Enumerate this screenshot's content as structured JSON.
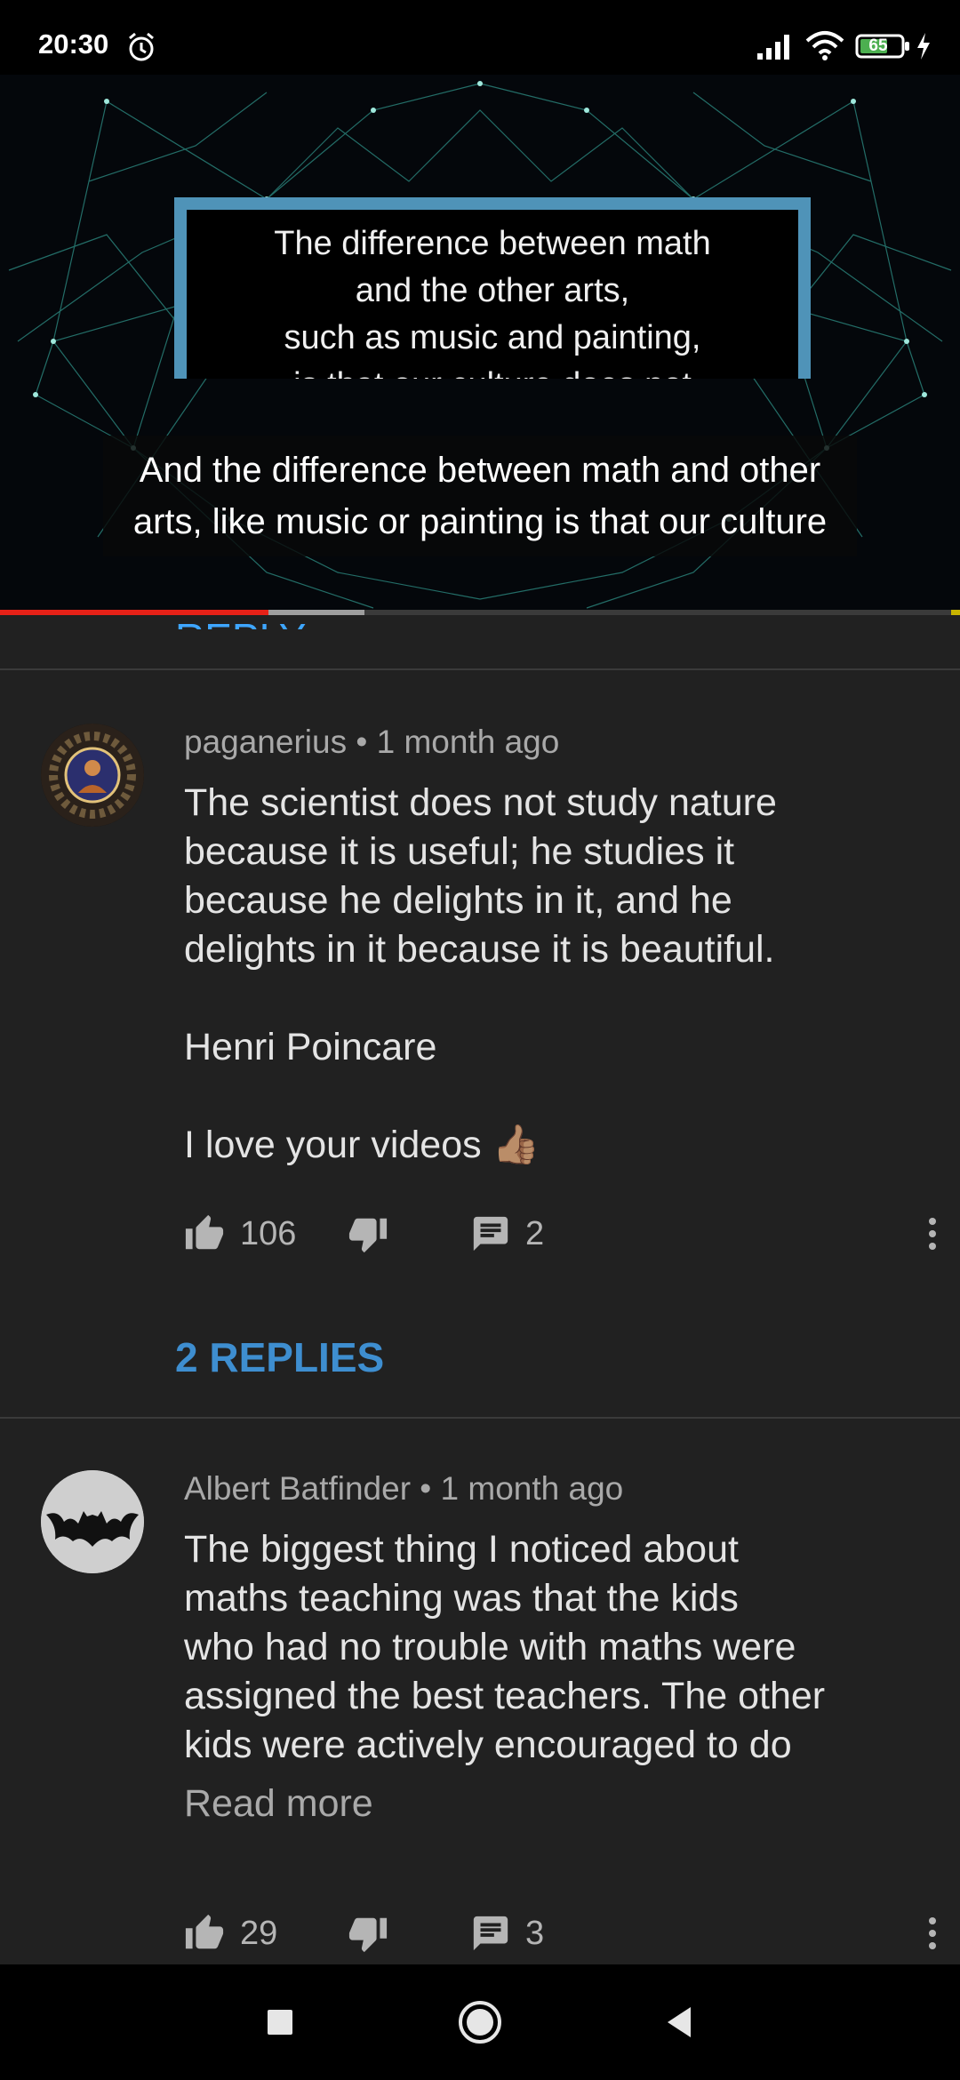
{
  "status_bar": {
    "time": "20:30",
    "battery": "65"
  },
  "video": {
    "card_text": "The difference between math\nand the other arts,\nsuch as music and painting,\nis that our culture does not\nrecognize it as such.",
    "caption_line1": "And the difference between math and other",
    "caption_line2": "arts, like music or painting is that our culture",
    "progress": 0.28,
    "buffered": 0.38
  },
  "partial_reply_text": "REPLY",
  "comments": [
    {
      "author": "paganerius",
      "age": "1 month ago",
      "meta": "paganerius • 1 month ago",
      "lines": [
        "The scientist does not study nature",
        "because it is useful; he studies it",
        "because he delights in it, and he",
        "delights in it because it is beautiful.",
        "",
        "Henri Poincare",
        "",
        "I love your videos 👍🏽"
      ],
      "likes": "106",
      "replies": "2",
      "replies_link": "2 REPLIES"
    },
    {
      "author": "Albert Batfinder",
      "age": "1 month ago",
      "meta": "Albert Batfinder • 1 month ago",
      "lines": [
        "The biggest thing I noticed about",
        "maths teaching was that the kids",
        "who had no trouble with maths were",
        "assigned the best teachers. The other",
        "kids were actively encouraged to do"
      ],
      "read_more": "Read more",
      "likes": "29",
      "replies": "3"
    }
  ],
  "icons": {
    "status": [
      "alarm-icon",
      "signal-icon",
      "wifi-icon",
      "battery-icon",
      "charging-icon"
    ],
    "actions": [
      "thumb-up-icon",
      "thumb-down-icon",
      "comment-icon",
      "more-vert-icon"
    ],
    "nav": [
      "recents-square-icon",
      "home-circle-icon",
      "back-triangle-icon"
    ]
  },
  "colors": {
    "accent_blue": "#3e8ed0",
    "progress_red": "#e62117",
    "background": "#212121"
  }
}
